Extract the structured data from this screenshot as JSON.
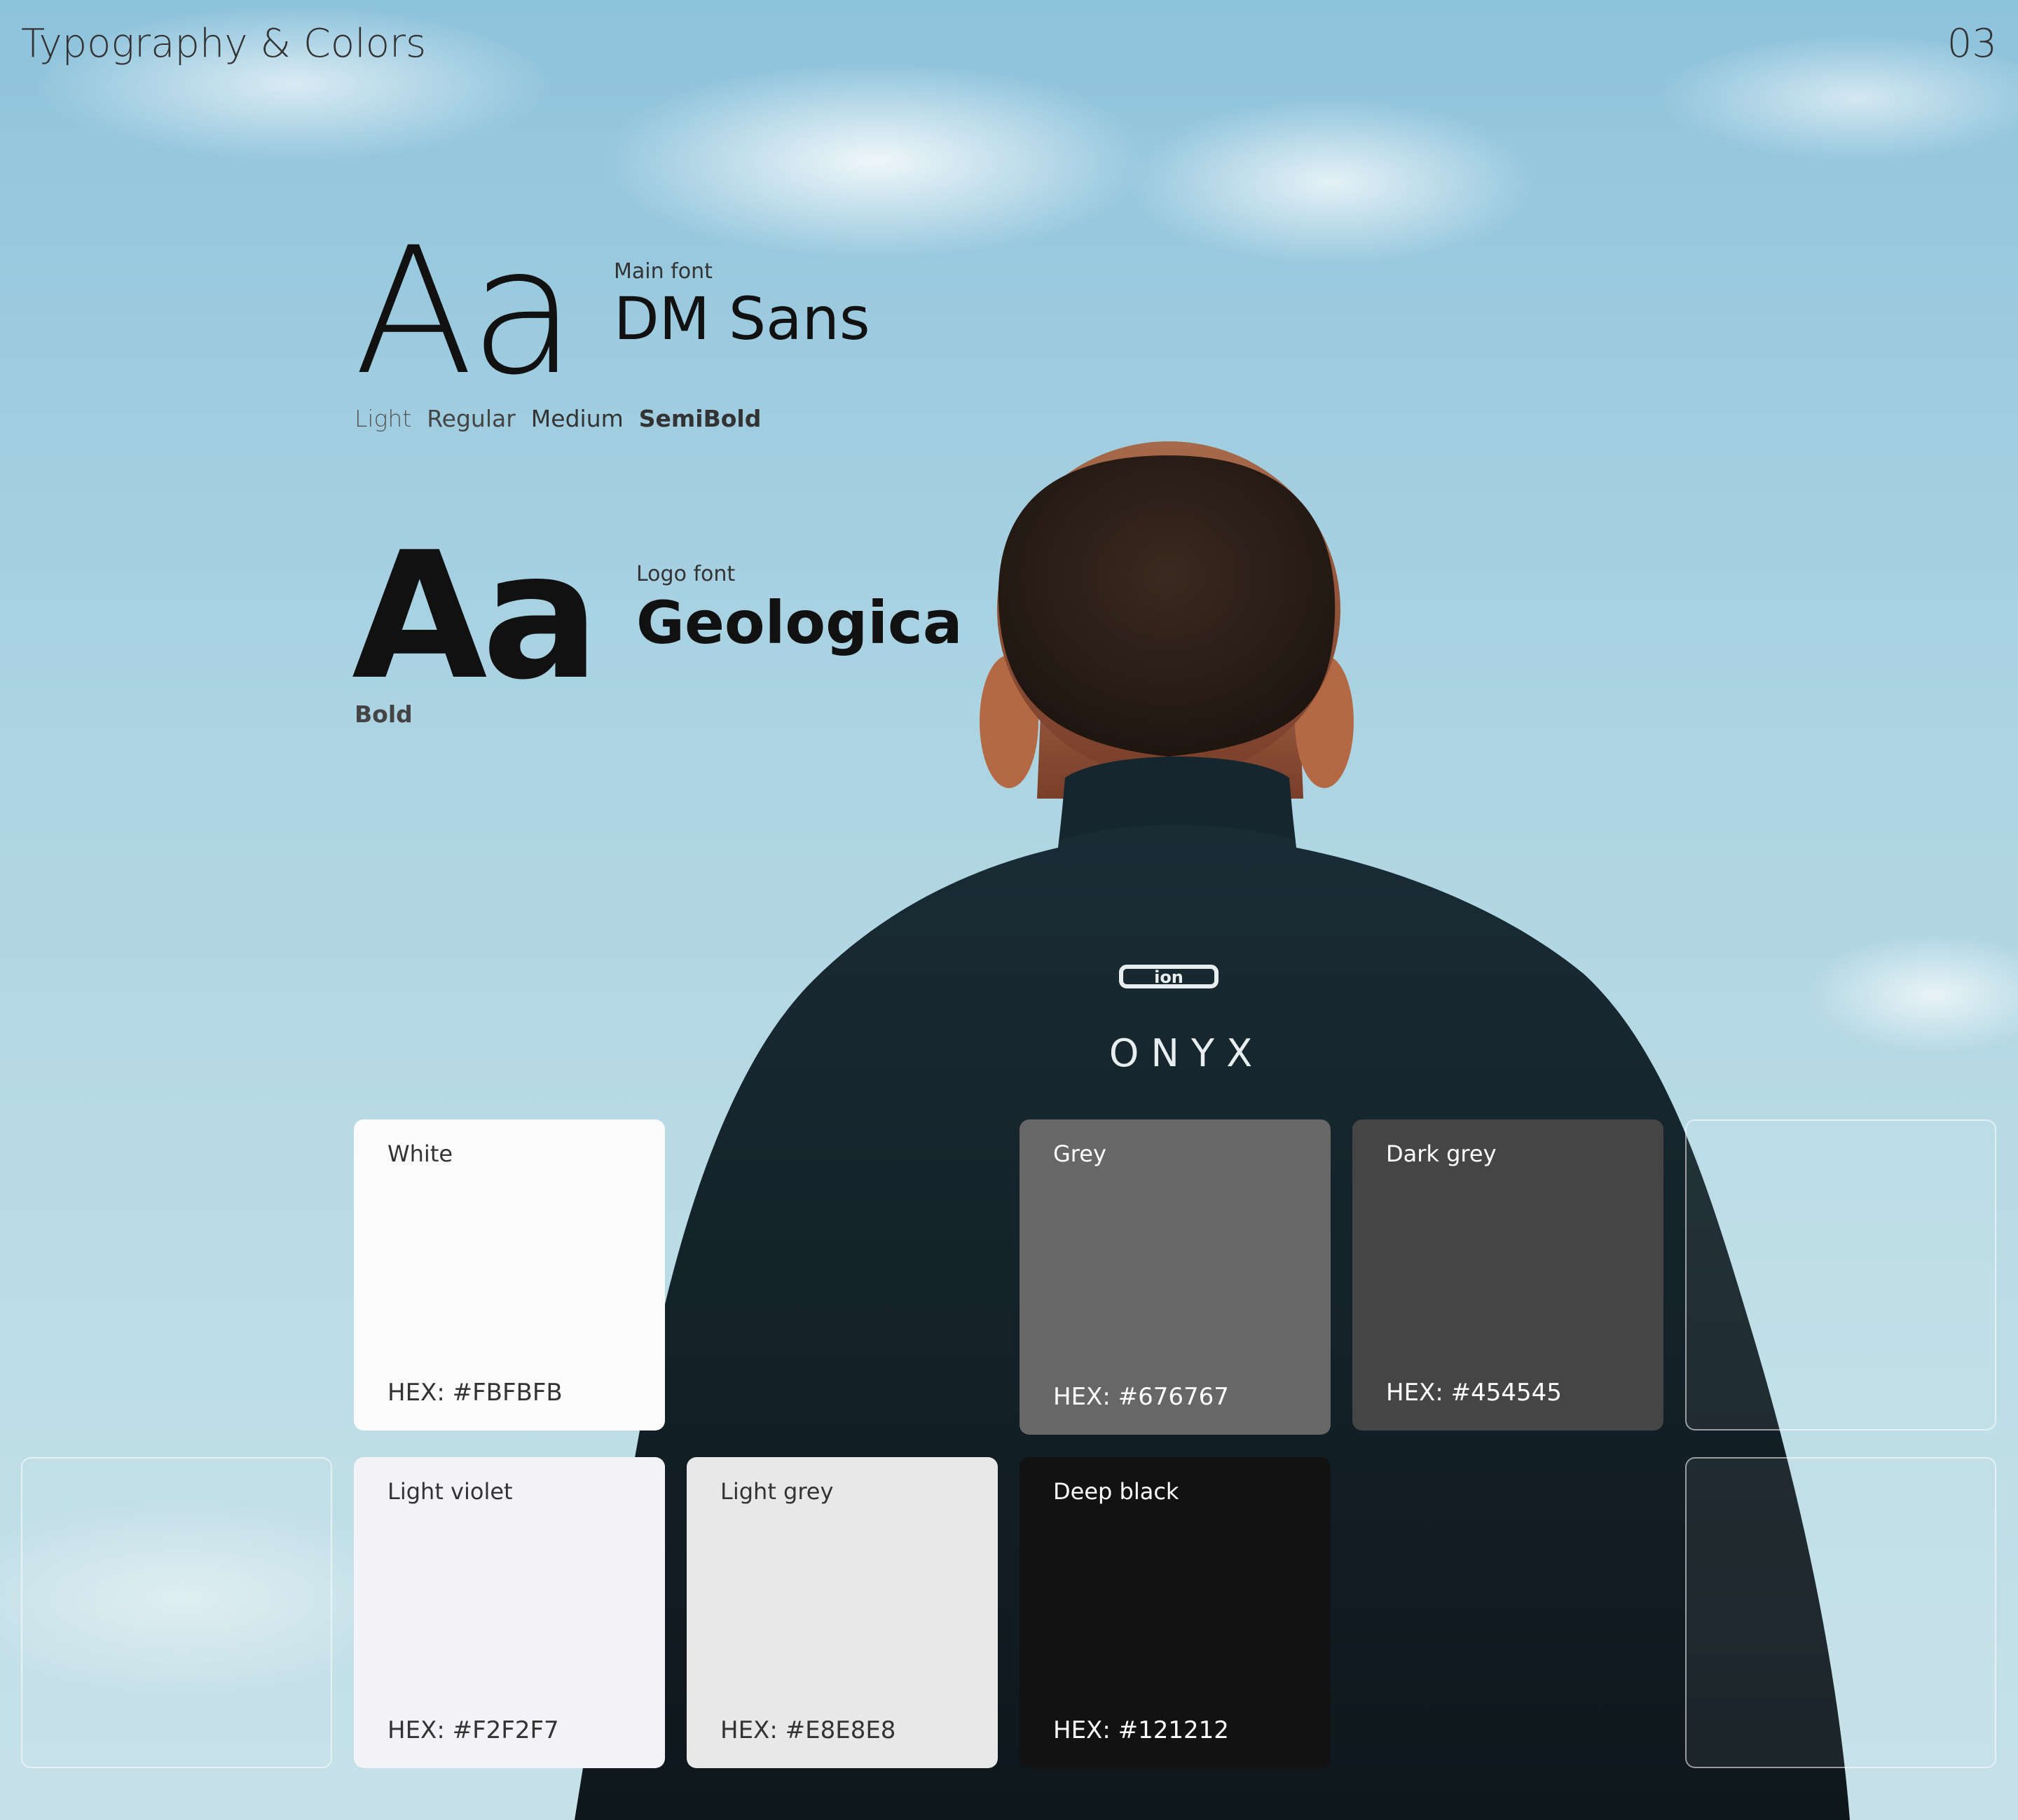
{
  "header": {
    "title": "Typography & Colors",
    "page_number": "03"
  },
  "typography": {
    "main": {
      "sample": "Aa",
      "label": "Main font",
      "name": "DM Sans",
      "weights": [
        "Light",
        "Regular",
        "Medium",
        "SemiBold"
      ]
    },
    "logo": {
      "sample": "Aa",
      "label": "Logo font",
      "name": "Geologica",
      "weight": "Bold"
    }
  },
  "photo": {
    "brand_mark": "ion",
    "chest_text": "O N Y X"
  },
  "colors": [
    {
      "name": "White",
      "hex": "HEX: #FBFBFB",
      "color": "#FBFBFB",
      "text_color": "#333333"
    },
    {
      "name": "Grey",
      "hex": "HEX: #676767",
      "color": "#676767",
      "text_color": "#ffffff"
    },
    {
      "name": "Dark grey",
      "hex": "HEX: #454545",
      "color": "#454545",
      "text_color": "#ffffff"
    },
    {
      "name": "Light violet",
      "hex": "HEX: #F2F2F7",
      "color": "#F2F2F7",
      "text_color": "#333333"
    },
    {
      "name": "Light grey",
      "hex": "HEX: #E8E8E8",
      "color": "#E8E8E8",
      "text_color": "#333333"
    },
    {
      "name": "Deep black",
      "hex": "HEX: #121212",
      "color": "#121212",
      "text_color": "#ffffff"
    }
  ]
}
